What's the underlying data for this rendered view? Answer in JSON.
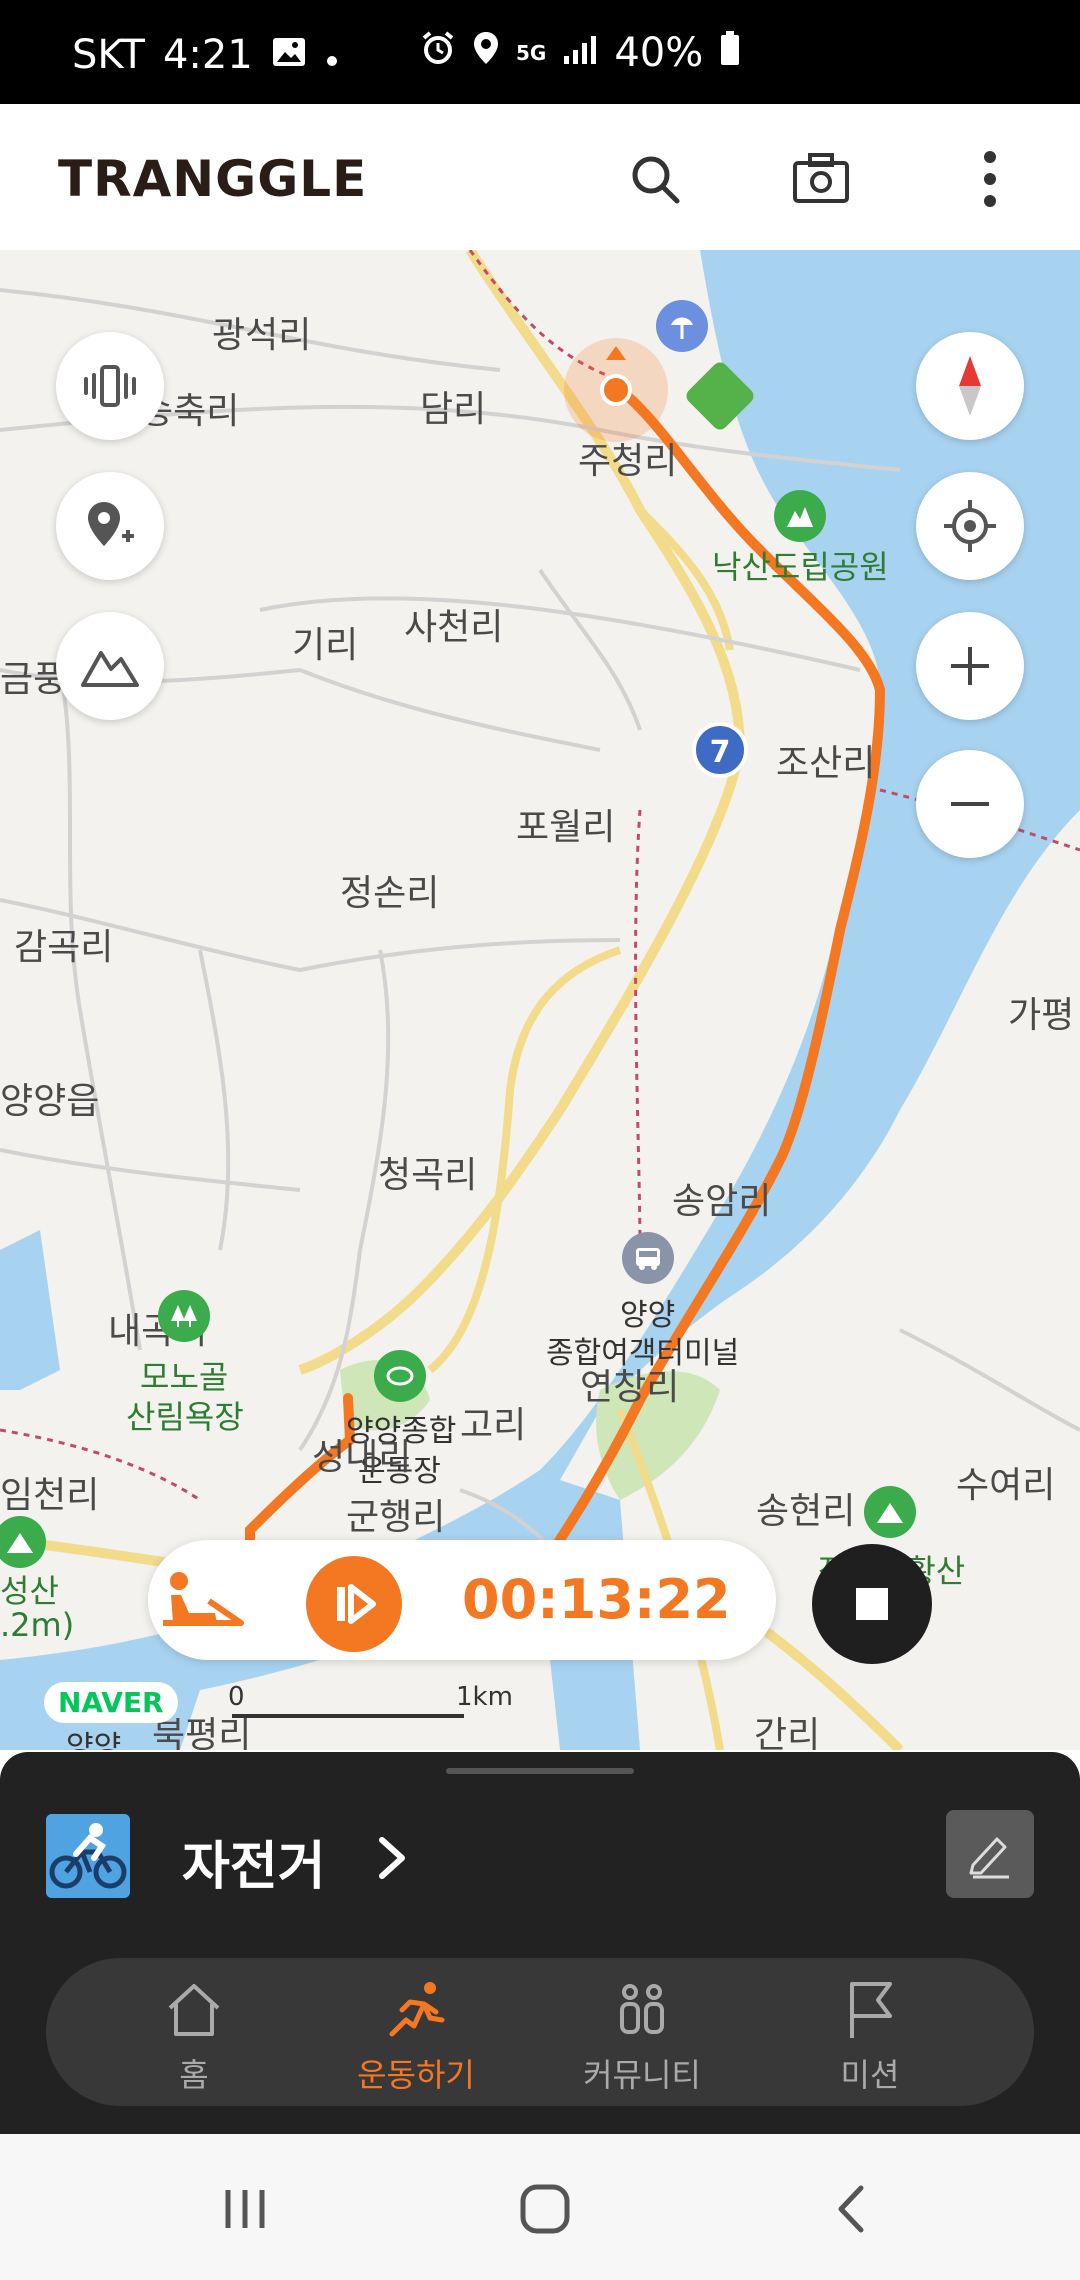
{
  "status_bar": {
    "carrier": "SKT",
    "time": "4:21",
    "network": "5G",
    "battery": "40%"
  },
  "header": {
    "logo": "TRANGGLE",
    "icons": [
      "search-icon",
      "camera-icon",
      "more-vertical-icon"
    ]
  },
  "map": {
    "places": [
      "광석리",
      "송축리",
      "담리",
      "주청리",
      "낙산도립공원",
      "기리",
      "사천리",
      "금풍",
      "조산리",
      "포월리",
      "정손리",
      "감곡리",
      "양양읍",
      "가평",
      "청곡리",
      "송암리",
      "내곡리",
      "모노골",
      "산림욕장",
      "양양",
      "종합여객터미널",
      "연창리",
      "양양종합",
      "운동장",
      "성내리",
      "고리",
      "군행리",
      "임천리",
      "성산",
      ".2m)",
      "송현리",
      "작은성황산",
      "수여리",
      "북평리",
      "간리",
      "양양"
    ],
    "route_badge": "7",
    "attribution": "NAVER",
    "scale_start": "0",
    "scale_end": "1km"
  },
  "tracker": {
    "elapsed_time": "00:13:22"
  },
  "sheet": {
    "activity": "자전거"
  },
  "tabs": [
    {
      "label": "홈",
      "icon": "home-icon"
    },
    {
      "label": "운동하기",
      "icon": "running-icon"
    },
    {
      "label": "커뮤니티",
      "icon": "community-icon"
    },
    {
      "label": "미션",
      "icon": "flag-icon"
    }
  ],
  "colors": {
    "accent": "#f47721",
    "sheet_bg": "#222222",
    "water": "#a8d3f0"
  }
}
